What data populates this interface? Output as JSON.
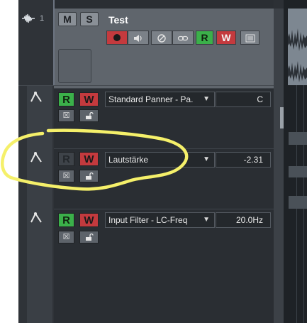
{
  "track": {
    "number": "1",
    "name": "Test",
    "mute_label": "M",
    "solo_label": "S",
    "read_label": "R",
    "write_label": "W",
    "icons": [
      "waveform-icon",
      "record-icon",
      "monitor-icon",
      "edit-icon",
      "link-icon",
      "list-icon"
    ]
  },
  "lanes": [
    {
      "read_label": "R",
      "write_label": "W",
      "read_active": true,
      "parameter": "Standard Panner - Pa.",
      "value": "C"
    },
    {
      "read_label": "R",
      "write_label": "W",
      "read_active": false,
      "parameter": "Lautstärke",
      "value": "-2.31"
    },
    {
      "read_label": "R",
      "write_label": "W",
      "read_active": true,
      "parameter": "Input Filter - LC-Freq",
      "value": "20.0Hz"
    }
  ],
  "colors": {
    "read_green": "#3bb04a",
    "write_red": "#c43a3e",
    "highlight_yellow": "#f5f06a",
    "background": "#2a2e33"
  }
}
